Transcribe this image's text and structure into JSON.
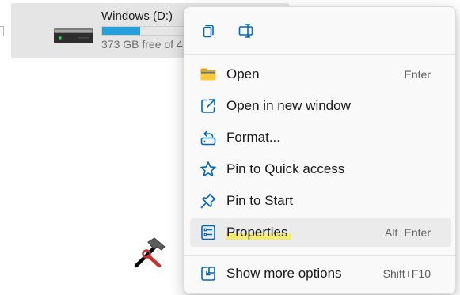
{
  "drive": {
    "name": "Windows (D:)",
    "free_text": "373 GB free of 4",
    "used_fraction": 0.2,
    "bar_color": "#26a0da",
    "icon": "hard-drive-icon"
  },
  "context_menu": {
    "toolbar": [
      {
        "name": "copy",
        "icon": "copy-icon"
      },
      {
        "name": "rename",
        "icon": "rename-icon"
      }
    ],
    "items": [
      {
        "label": "Open",
        "shortcut": "Enter",
        "icon": "folder-open-icon"
      },
      {
        "label": "Open in new window",
        "shortcut": "",
        "icon": "open-new-window-icon"
      },
      {
        "label": "Format...",
        "shortcut": "",
        "icon": "format-icon"
      },
      {
        "label": "Pin to Quick access",
        "shortcut": "",
        "icon": "star-icon"
      },
      {
        "label": "Pin to Start",
        "shortcut": "",
        "icon": "pin-icon"
      },
      {
        "label": "Properties",
        "shortcut": "Alt+Enter",
        "icon": "properties-icon",
        "highlighted": true
      },
      {
        "label": "Show more options",
        "shortcut": "Shift+F10",
        "icon": "show-more-options-icon"
      }
    ],
    "accent_color": "#0067c0",
    "highlight_color": "#ffec00"
  },
  "overlay": {
    "icon": "hammer-wrench-icon"
  }
}
